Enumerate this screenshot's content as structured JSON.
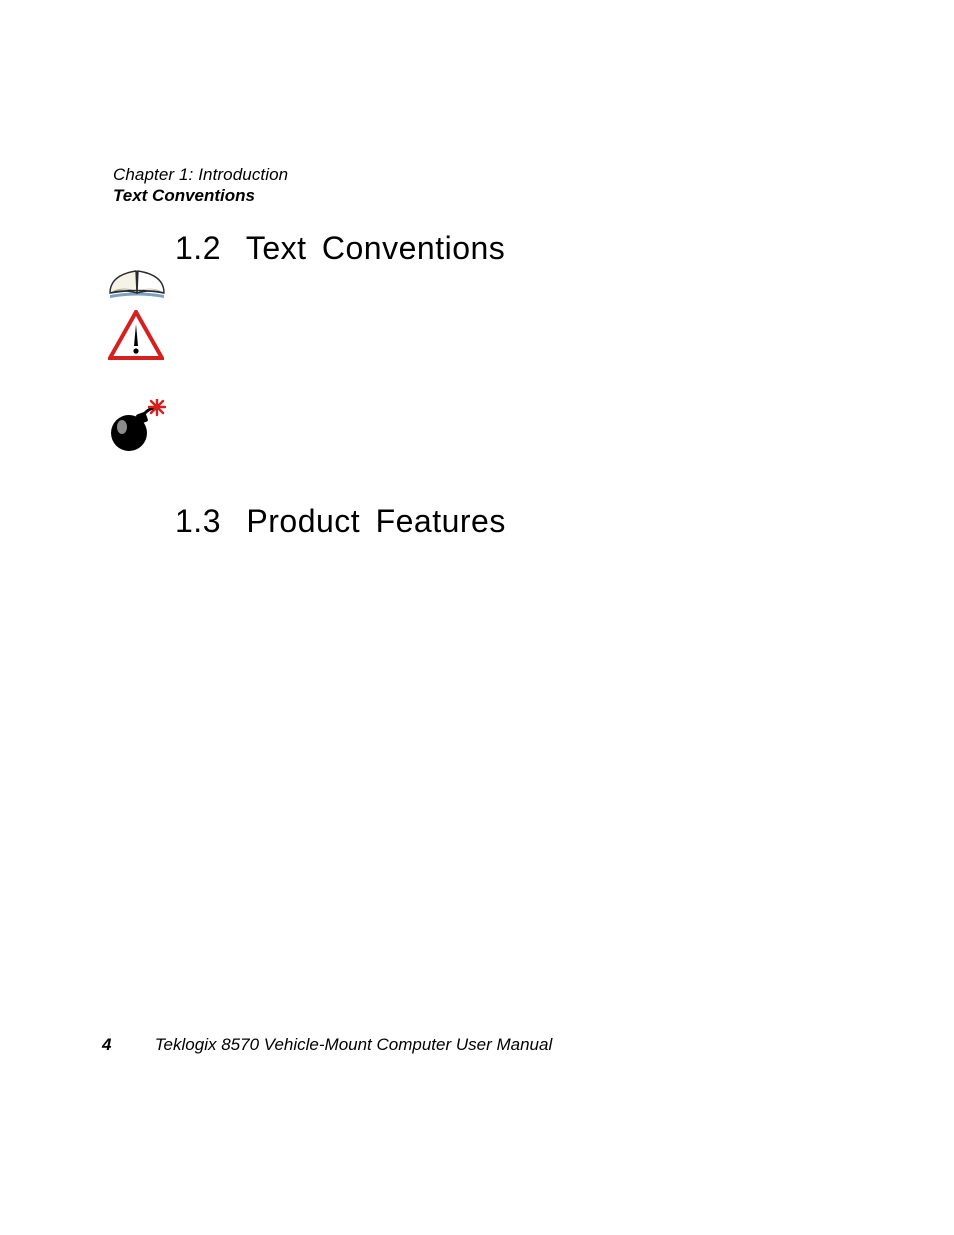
{
  "header": {
    "chapter_line": "Chapter 1:  Introduction",
    "section_line": "Text Conventions"
  },
  "sections": {
    "s12": {
      "number": "1.2",
      "title": "Text Conventions"
    },
    "s13": {
      "number": "1.3",
      "title": "Product Features"
    }
  },
  "icons": {
    "note": "open-book-icon",
    "important": "warning-triangle-icon",
    "warning": "bomb-icon"
  },
  "footer": {
    "page_number": "4",
    "manual_title": "Teklogix 8570 Vehicle-Mount Computer User Manual"
  }
}
